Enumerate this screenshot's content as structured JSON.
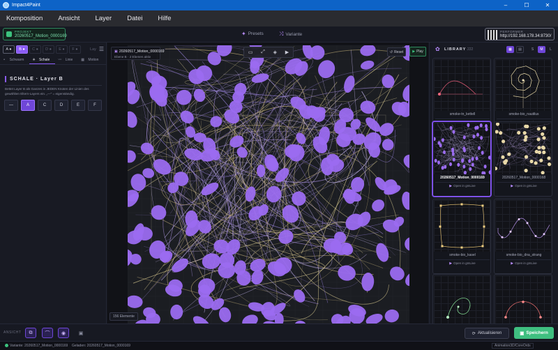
{
  "window": {
    "title": "Impact4Paint",
    "controls": [
      "–",
      "☐",
      "✕"
    ]
  },
  "menu": [
    "Komposition",
    "Ansicht",
    "Layer",
    "Datei",
    "Hilfe"
  ],
  "topbar": {
    "project_label": "PROJEKT",
    "project_value": "20260517_Motion_0000169",
    "presets_label": "Presets",
    "variante_label": "Variante",
    "performer_label": "PERFORMER",
    "performer_url": "http://192.168.178.34:8730/"
  },
  "left": {
    "layers": [
      "A ●",
      "B ●",
      "C ●",
      "D ●",
      "E ●",
      "F ●"
    ],
    "active_layer": 1,
    "layers_label": "Lay",
    "subtabs": [
      "Schwarm",
      "Schale",
      "Linie",
      "Motion",
      "Bl"
    ],
    "active_subtab": 1,
    "section_title": "SCHALE · Layer B",
    "section_desc": "Bettet Layer B als Ganzes in JEDEN Knoten der Linien des gewählten Eltern-Layers ein. „—\" = eigenständig.",
    "options": [
      "—",
      "A",
      "C",
      "D",
      "E",
      "F"
    ],
    "active_option": 1
  },
  "canvas": {
    "info_title": "20260517_Motion_0000169",
    "info_sub": "Ebene B · 2 Ebenen aktiv",
    "toolbar_icons": [
      "monitor-icon",
      "expand-icon",
      "layers-icon",
      "play-triangle-icon"
    ],
    "reset_label": "Reset",
    "play_label": "Play",
    "element_count": "156 Elemente"
  },
  "library": {
    "title": "LIBRARY",
    "count": "222",
    "sizes": [
      "S",
      "M",
      "L"
    ],
    "active_size": "M",
    "open_label": "Open in gmLive",
    "items": [
      {
        "name": "smoke-tn_kettell",
        "selected": false
      },
      {
        "name": "smoke-bio_nautilus",
        "selected": false
      },
      {
        "name": "20260517_Motion_0000169",
        "selected": true
      },
      {
        "name": "20260517_Motion_0000168",
        "selected": false
      },
      {
        "name": "smoke-bio_kasel",
        "selected": false
      },
      {
        "name": "smoke-bio_dna_strang",
        "selected": false
      },
      {
        "name": "",
        "selected": false
      },
      {
        "name": "",
        "selected": false
      }
    ]
  },
  "bottom": {
    "ansicht_label": "ANSICHT",
    "aktualisieren_label": "Aktualisieren",
    "save_label": "Speichern"
  },
  "status": {
    "variante": "Variante: 20260517_Motion_0000169",
    "geladen": "Geladen: 20260517_Motion_0000169",
    "path": "Animation3D/CoreOrds"
  },
  "colors": {
    "accent": "#8b5cf6",
    "save": "#3fbf80",
    "titlebar": "#0d63c7",
    "blob": "#9b6cf0"
  }
}
